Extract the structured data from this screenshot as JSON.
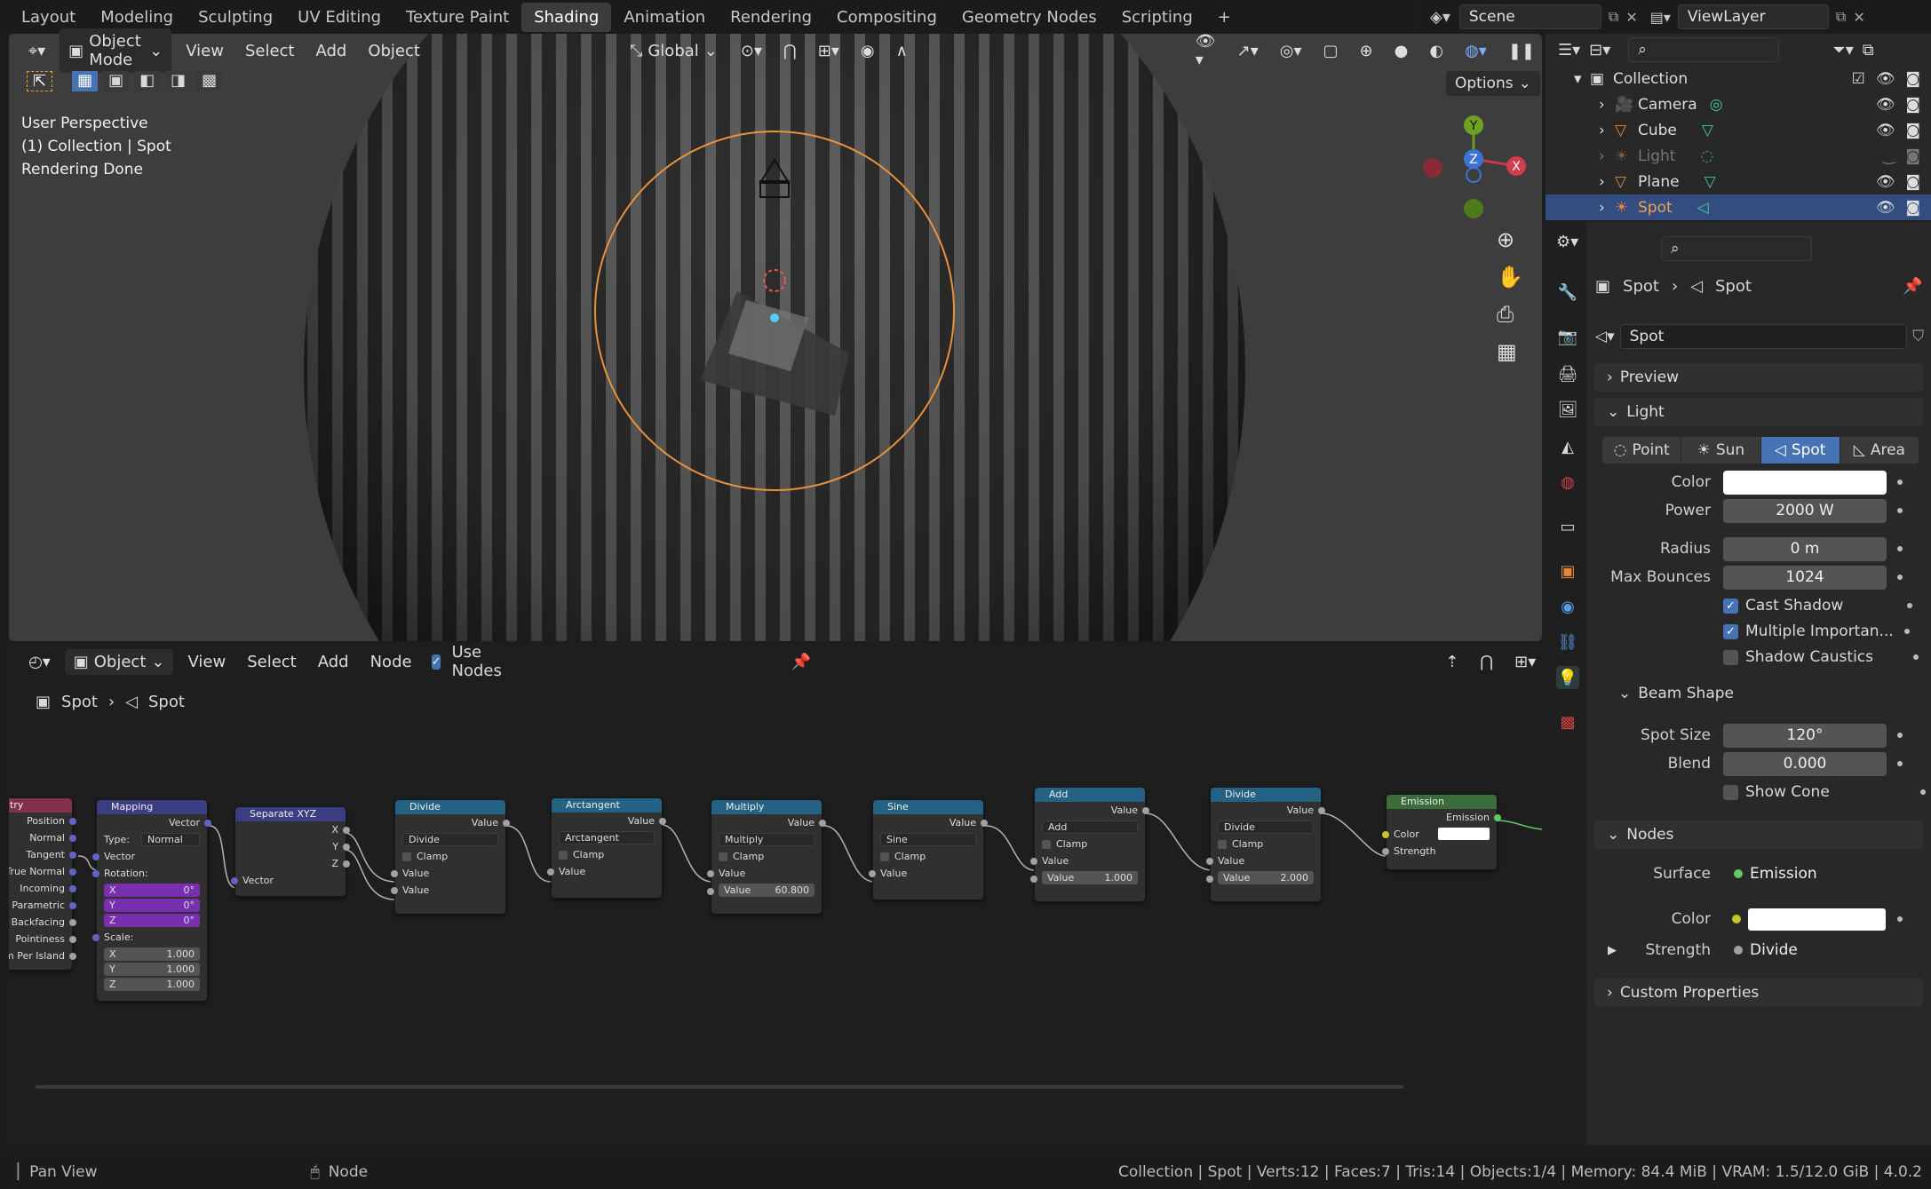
{
  "workspace_tabs": [
    "Layout",
    "Modeling",
    "Sculpting",
    "UV Editing",
    "Texture Paint",
    "Shading",
    "Animation",
    "Rendering",
    "Compositing",
    "Geometry Nodes",
    "Scripting"
  ],
  "active_tab": "Shading",
  "scene": "Scene",
  "view_layer": "ViewLayer",
  "viewport": {
    "mode": "Object Mode",
    "menus": [
      "View",
      "Select",
      "Add",
      "Object"
    ],
    "transform": "Global",
    "options": "Options",
    "info": [
      "User Perspective",
      "(1) Collection | Spot",
      "Rendering Done"
    ],
    "gizmo": {
      "y": "Y",
      "z": "Z",
      "x": "X"
    }
  },
  "node_editor": {
    "type": "Object",
    "menus": [
      "View",
      "Select",
      "Add",
      "Node"
    ],
    "use_nodes": "Use Nodes",
    "breadcrumb": [
      "Spot",
      "Spot"
    ],
    "nodes": {
      "geometry": {
        "title": "try",
        "outputs": [
          "Position",
          "Normal",
          "Tangent",
          "True Normal",
          "Incoming",
          "Parametric",
          "Backfacing",
          "Pointiness",
          "om Per Island"
        ]
      },
      "mapping": {
        "title": "Mapping",
        "out": "Vector",
        "type_label": "Type:",
        "type_value": "Normal",
        "vector": "Vector",
        "rotation": "Rotation:",
        "rx": "X",
        "ry": "Y",
        "rz": "Z",
        "rv": "0°",
        "scale": "Scale:",
        "sv": "1.000"
      },
      "separate": {
        "title": "Separate XYZ",
        "x": "X",
        "y": "Y",
        "z": "Z",
        "in": "Vector"
      },
      "divide1": {
        "title": "Divide",
        "out": "Value",
        "op": "Divide",
        "clamp": "Clamp",
        "in1": "Value",
        "in2": "Value"
      },
      "arctan": {
        "title": "Arctangent",
        "out": "Value",
        "op": "Arctangent",
        "clamp": "Clamp",
        "in1": "Value"
      },
      "multiply": {
        "title": "Multiply",
        "out": "Value",
        "op": "Multiply",
        "clamp": "Clamp",
        "in1": "Value",
        "in2_label": "Value",
        "in2_val": "60.800"
      },
      "sine": {
        "title": "Sine",
        "out": "Value",
        "op": "Sine",
        "clamp": "Clamp",
        "in1": "Value"
      },
      "add": {
        "title": "Add",
        "out": "Value",
        "op": "Add",
        "clamp": "Clamp",
        "in1": "Value",
        "in2_label": "Value",
        "in2_val": "1.000"
      },
      "divide2": {
        "title": "Divide",
        "out": "Value",
        "op": "Divide",
        "clamp": "Clamp",
        "in1": "Value",
        "in2_label": "Value",
        "in2_val": "2.000"
      },
      "emission": {
        "title": "Emission",
        "out": "Emission",
        "color": "Color",
        "strength": "Strength"
      }
    }
  },
  "outliner": {
    "collection": "Collection",
    "items": [
      {
        "name": "Camera"
      },
      {
        "name": "Cube"
      },
      {
        "name": "Light"
      },
      {
        "name": "Plane"
      },
      {
        "name": "Spot"
      }
    ]
  },
  "properties": {
    "breadcrumb": [
      "Spot",
      "Spot"
    ],
    "datablock": "Spot",
    "preview": "Preview",
    "light": "Light",
    "light_types": [
      "Point",
      "Sun",
      "Spot",
      "Area"
    ],
    "active_type": "Spot",
    "color_label": "Color",
    "power_label": "Power",
    "power": "2000 W",
    "radius_label": "Radius",
    "radius": "0 m",
    "bounces_label": "Max Bounces",
    "bounces": "1024",
    "cast_shadow": "Cast Shadow",
    "mis": "Multiple Importan...",
    "shadow_caustics": "Shadow Caustics",
    "beam_shape": "Beam Shape",
    "spot_size_label": "Spot Size",
    "spot_size": "120°",
    "blend_label": "Blend",
    "blend": "0.000",
    "show_cone": "Show Cone",
    "nodes": "Nodes",
    "surface_label": "Surface",
    "surface": "Emission",
    "ncolor_label": "Color",
    "strength_label": "Strength",
    "strength": "Divide",
    "custom_props": "Custom Properties"
  },
  "status": {
    "left": "Pan View",
    "mid": "Node",
    "right": "Collection | Spot | Verts:12 | Faces:7 | Tris:14 | Objects:1/4 | Memory: 84.4 MiB | VRAM: 1.5/12.0 GiB | 4.0.2"
  }
}
